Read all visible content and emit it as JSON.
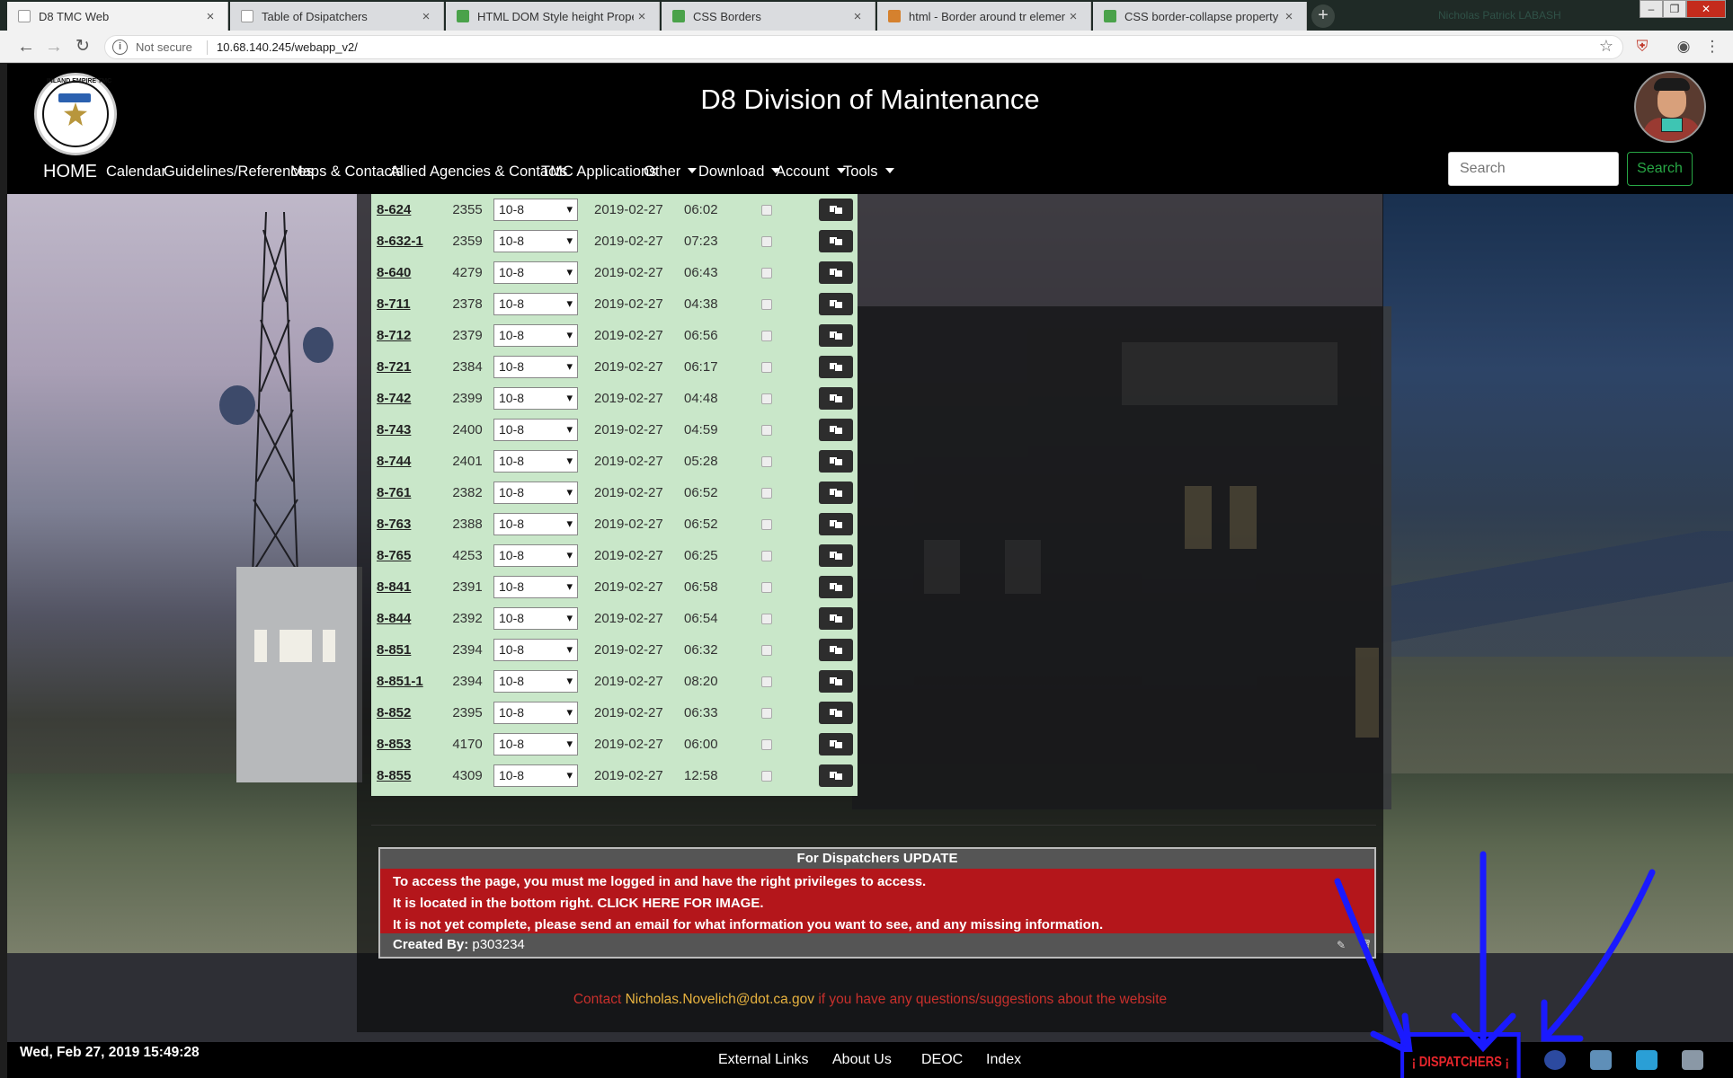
{
  "browser": {
    "tabs": [
      {
        "label": "D8 TMC Web",
        "active": true,
        "color": "#ffffff"
      },
      {
        "label": "Table of Dsipatchers",
        "active": false,
        "color": "#ffffff"
      },
      {
        "label": "HTML DOM Style height Propert",
        "active": false,
        "color": "#4aa24a"
      },
      {
        "label": "CSS Borders",
        "active": false,
        "color": "#4aa24a"
      },
      {
        "label": "html - Border around tr element",
        "active": false,
        "color": "#d5812e"
      },
      {
        "label": "CSS border-collapse property",
        "active": false,
        "color": "#4aa24a"
      }
    ],
    "tab_close": "×",
    "new_tab": "+",
    "profile_name": "Nicholas Patrick LABASH",
    "security_label": "Not secure",
    "url": "10.68.140.245/webapp_v2/"
  },
  "header": {
    "title": "D8 Division of Maintenance",
    "logo_text": "INLAND EMPIRE TMC"
  },
  "nav": {
    "home": "HOME",
    "items": [
      {
        "label": "Calendar",
        "dropdown": false
      },
      {
        "label": "Guidelines/References",
        "dropdown": false
      },
      {
        "label": "Maps & Contacts",
        "dropdown": false
      },
      {
        "label": "Allied Agencies & Contacts",
        "dropdown": false
      },
      {
        "label": "TMC Applications",
        "dropdown": false
      },
      {
        "label": "Other",
        "dropdown": true
      },
      {
        "label": "Download",
        "dropdown": true
      },
      {
        "label": "Account",
        "dropdown": true
      },
      {
        "label": "Tools",
        "dropdown": true
      }
    ],
    "search_placeholder": "Search",
    "search_button": "Search"
  },
  "dispatch_table": {
    "rows": [
      {
        "unit": "8-624",
        "num": "2355",
        "status": "10-8",
        "date": "2019-02-27",
        "time": "06:02"
      },
      {
        "unit": "8-632-1",
        "num": "2359",
        "status": "10-8",
        "date": "2019-02-27",
        "time": "07:23"
      },
      {
        "unit": "8-640",
        "num": "4279",
        "status": "10-8",
        "date": "2019-02-27",
        "time": "06:43"
      },
      {
        "unit": "8-711",
        "num": "2378",
        "status": "10-8",
        "date": "2019-02-27",
        "time": "04:38"
      },
      {
        "unit": "8-712",
        "num": "2379",
        "status": "10-8",
        "date": "2019-02-27",
        "time": "06:56"
      },
      {
        "unit": "8-721",
        "num": "2384",
        "status": "10-8",
        "date": "2019-02-27",
        "time": "06:17"
      },
      {
        "unit": "8-742",
        "num": "2399",
        "status": "10-8",
        "date": "2019-02-27",
        "time": "04:48"
      },
      {
        "unit": "8-743",
        "num": "2400",
        "status": "10-8",
        "date": "2019-02-27",
        "time": "04:59"
      },
      {
        "unit": "8-744",
        "num": "2401",
        "status": "10-8",
        "date": "2019-02-27",
        "time": "05:28"
      },
      {
        "unit": "8-761",
        "num": "2382",
        "status": "10-8",
        "date": "2019-02-27",
        "time": "06:52"
      },
      {
        "unit": "8-763",
        "num": "2388",
        "status": "10-8",
        "date": "2019-02-27",
        "time": "06:52"
      },
      {
        "unit": "8-765",
        "num": "4253",
        "status": "10-8",
        "date": "2019-02-27",
        "time": "06:25"
      },
      {
        "unit": "8-841",
        "num": "2391",
        "status": "10-8",
        "date": "2019-02-27",
        "time": "06:58"
      },
      {
        "unit": "8-844",
        "num": "2392",
        "status": "10-8",
        "date": "2019-02-27",
        "time": "06:54"
      },
      {
        "unit": "8-851",
        "num": "2394",
        "status": "10-8",
        "date": "2019-02-27",
        "time": "06:32"
      },
      {
        "unit": "8-851-1",
        "num": "2394",
        "status": "10-8",
        "date": "2019-02-27",
        "time": "08:20"
      },
      {
        "unit": "8-852",
        "num": "2395",
        "status": "10-8",
        "date": "2019-02-27",
        "time": "06:33"
      },
      {
        "unit": "8-853",
        "num": "4170",
        "status": "10-8",
        "date": "2019-02-27",
        "time": "06:00"
      },
      {
        "unit": "8-855",
        "num": "4309",
        "status": "10-8",
        "date": "2019-02-27",
        "time": "12:58"
      }
    ]
  },
  "update": {
    "title": "For Dispatchers UPDATE",
    "lines": [
      "To access the page, you must me logged in and have the right privileges to access.",
      "It is located in the bottom right. CLICK HERE FOR IMAGE.",
      "It is not yet complete, please send an email for what information you want to see, and any missing information."
    ],
    "created_label": "Created By:",
    "created_by": "p303234"
  },
  "contact": {
    "prefix": "Contact",
    "email": "Nicholas.Novelich@dot.ca.gov",
    "suffix": "if you have any questions/suggestions about the website"
  },
  "footer": {
    "datetime": "Wed, Feb 27, 2019 15:49:28",
    "links": [
      "External Links",
      "About Us",
      "DEOC",
      "Index"
    ],
    "dispatchers_button": "¡ DISPATCHERS ¡"
  },
  "colors": {
    "table_bg": "#c9e7c9",
    "alert_red": "#b4161b",
    "search_green": "#28a745",
    "annotation_blue": "#1a1aff"
  }
}
